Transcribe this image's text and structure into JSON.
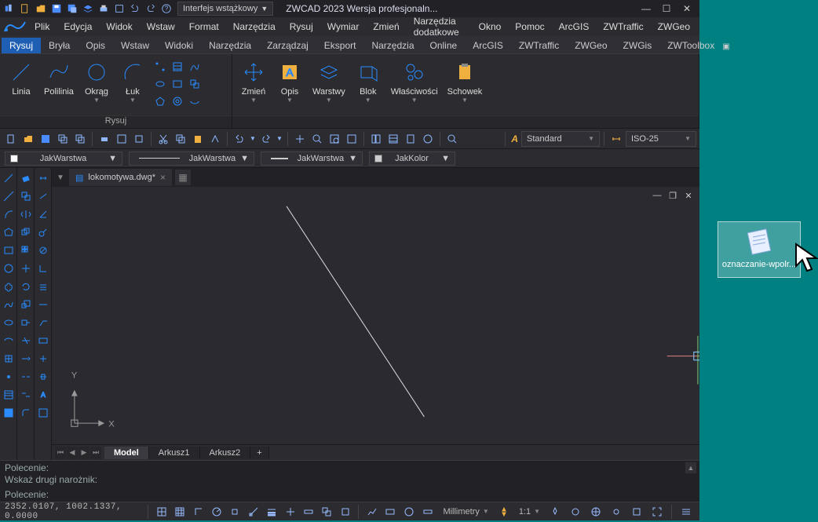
{
  "title": "ZWCAD 2023 Wersja profesjonaln...",
  "interface_mode": "Interfejs wstążkowy",
  "menus": [
    "Plik",
    "Edycja",
    "Widok",
    "Wstaw",
    "Format",
    "Narzędzia",
    "Rysuj",
    "Wymiar",
    "Zmień",
    "Narzędzia dodatkowe",
    "Okno",
    "Pomoc",
    "ArcGIS",
    "ZWTraffic",
    "ZWGeo"
  ],
  "ribbon_tabs": [
    "Rysuj",
    "Bryła",
    "Opis",
    "Wstaw",
    "Widoki",
    "Narzędzia",
    "Zarządzaj",
    "Eksport",
    "Narzędzia",
    "Online",
    "ArcGIS",
    "ZWTraffic",
    "ZWGeo",
    "ZWGis",
    "ZWToolbox"
  ],
  "active_ribbon_tab": "Rysuj",
  "ribbon": {
    "draw_panel": {
      "label": "Rysuj",
      "buttons": [
        "Linia",
        "Polilinia",
        "Okrąg",
        "Łuk"
      ]
    },
    "mod_panel_buttons": [
      "Zmień",
      "Opis",
      "Warstwy",
      "Blok",
      "Właściwości",
      "Schowek"
    ]
  },
  "text_style": "Standard",
  "dim_style": "ISO-25",
  "layer_bar": {
    "layer": "JakWarstwa",
    "linetype": "JakWarstwa",
    "lineweight": "JakWarstwa",
    "color": "JakKolor"
  },
  "document": {
    "name": "lokomotywa.dwg*"
  },
  "model_tabs": [
    "Model",
    "Arkusz1",
    "Arkusz2"
  ],
  "active_model_tab": "Model",
  "cmd": {
    "history": "Polecenie:\nWskaż drugi narożnik:",
    "prompt": "Polecenie:"
  },
  "status": {
    "coords": "2352.0107, 1002.1337, 0.0000",
    "units": "Millimetry",
    "scale": "1:1"
  },
  "desktop_file": "oznaczanie-wpolr..."
}
